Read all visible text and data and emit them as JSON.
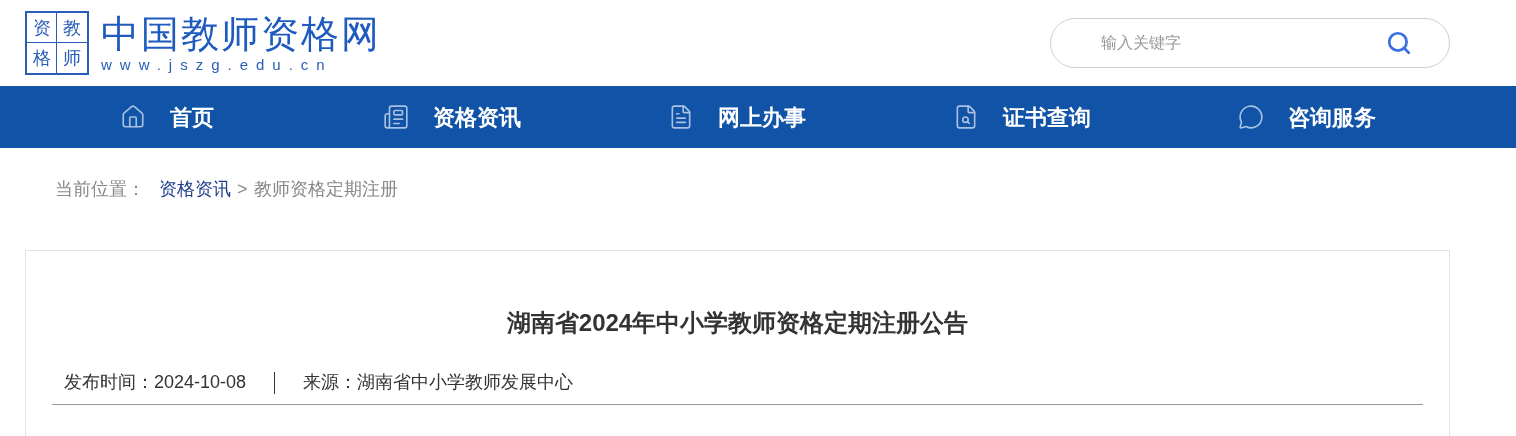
{
  "logo": {
    "seal": [
      "资",
      "教",
      "格",
      "师"
    ],
    "title": "中国教师资格网",
    "url": "www.jszg.edu.cn"
  },
  "search": {
    "placeholder": "输入关键字"
  },
  "nav": [
    {
      "label": "首页",
      "kind": "home"
    },
    {
      "label": "资格资讯",
      "kind": "news"
    },
    {
      "label": "网上办事",
      "kind": "file"
    },
    {
      "label": "证书查询",
      "kind": "query"
    },
    {
      "label": "咨询服务",
      "kind": "chat"
    }
  ],
  "breadcrumb": {
    "label": "当前位置：",
    "links": [
      "资格资讯"
    ],
    "separator": ">",
    "current": "教师资格定期注册"
  },
  "article": {
    "title": "湖南省2024年中小学教师资格定期注册公告",
    "published_label": "发布时间：",
    "published": "2024-10-08",
    "source_label": "来源：",
    "source": "湖南省中小学教师发展中心"
  }
}
